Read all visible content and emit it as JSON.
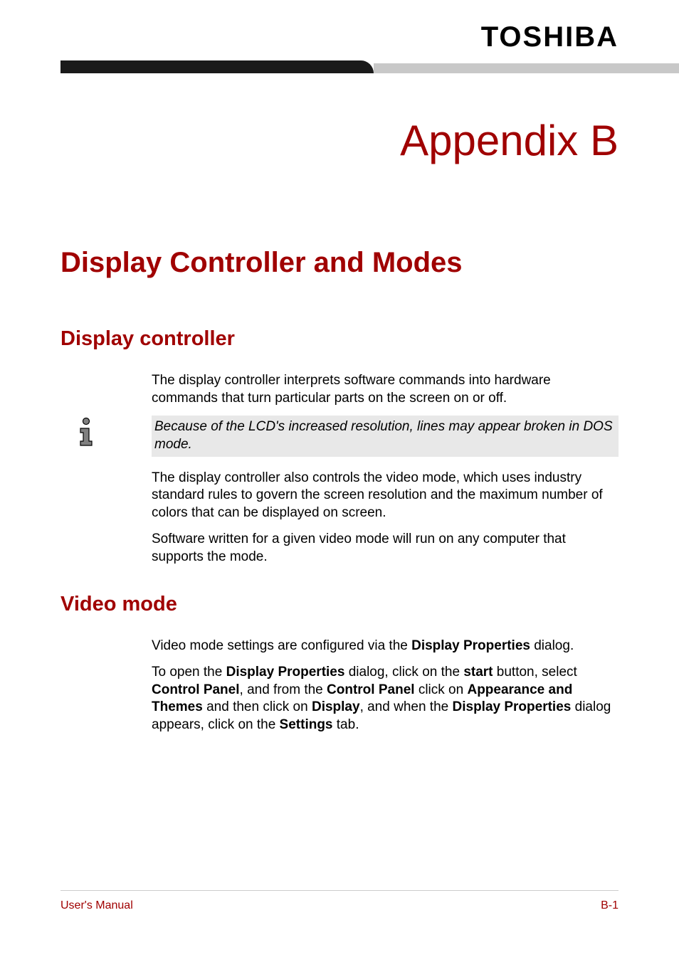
{
  "header": {
    "logo": "TOSHIBA"
  },
  "appendix_title": "Appendix B",
  "main_heading": "Display Controller and Modes",
  "section1": {
    "heading": "Display controller",
    "para1": "The display controller interprets software commands into hardware commands that turn particular parts on the screen on or off.",
    "note": "Because of the LCD's increased resolution, lines may appear broken in DOS mode.",
    "para2": "The display controller also controls the video mode, which uses industry standard rules to govern the screen resolution and the maximum number of colors that can be displayed on screen.",
    "para3": "Software written for a given video mode will run on any computer that supports the mode."
  },
  "section2": {
    "heading": "Video mode",
    "para1_prefix": "Video mode settings are configured via the ",
    "para1_bold1": "Display Properties",
    "para1_suffix": " dialog.",
    "para2_1": "To open the ",
    "para2_b1": "Display Properties",
    "para2_2": " dialog, click on the ",
    "para2_b2": "start",
    "para2_3": " button, select ",
    "para2_b3": "Control Panel",
    "para2_4": ", and from the ",
    "para2_b4": "Control Panel",
    "para2_5": " click on ",
    "para2_b5": "Appearance and Themes",
    "para2_6": " and then click on ",
    "para2_b6": "Display",
    "para2_7": ", and when the ",
    "para2_b7": "Display Properties",
    "para2_8": " dialog appears, click on the ",
    "para2_b8": "Settings",
    "para2_9": " tab."
  },
  "footer": {
    "left": "User's Manual",
    "right": "B-1"
  }
}
